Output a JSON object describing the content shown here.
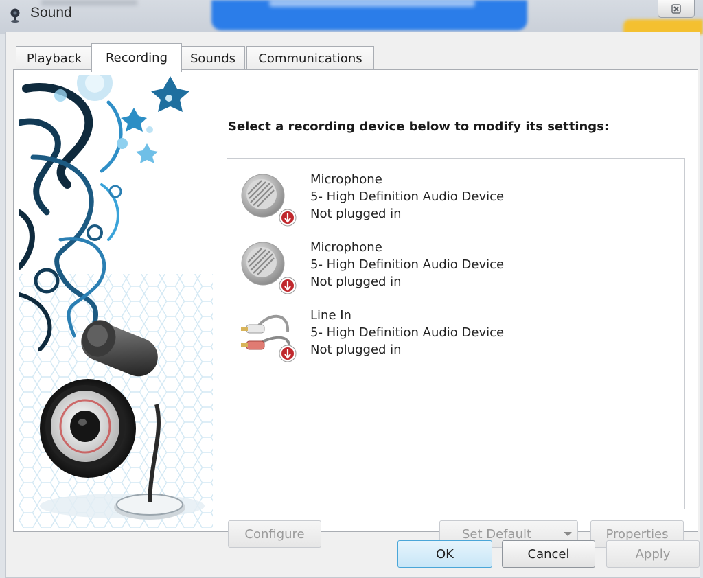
{
  "window": {
    "title": "Sound",
    "icons": {
      "app": "speaker-icon",
      "close": "close-icon"
    }
  },
  "tabs": [
    {
      "label": "Playback",
      "active": false
    },
    {
      "label": "Recording",
      "active": true
    },
    {
      "label": "Sounds",
      "active": false
    },
    {
      "label": "Communications",
      "active": false
    }
  ],
  "recording": {
    "instruction": "Select a recording device below to modify its settings:",
    "devices": [
      {
        "name": "Microphone",
        "driver": "5- High Definition Audio Device",
        "status": "Not plugged in",
        "icon": "microphone-icon"
      },
      {
        "name": "Microphone",
        "driver": "5- High Definition Audio Device",
        "status": "Not plugged in",
        "icon": "microphone-icon"
      },
      {
        "name": "Line In",
        "driver": "5- High Definition Audio Device",
        "status": "Not plugged in",
        "icon": "line-in-cable-icon"
      }
    ],
    "buttons": {
      "configure": "Configure",
      "set_default": "Set Default",
      "properties": "Properties"
    }
  },
  "dialog_buttons": {
    "ok": "OK",
    "cancel": "Cancel",
    "apply": "Apply"
  },
  "colors": {
    "accent": "#4aa6d8",
    "status_badge": "#c0282d"
  }
}
